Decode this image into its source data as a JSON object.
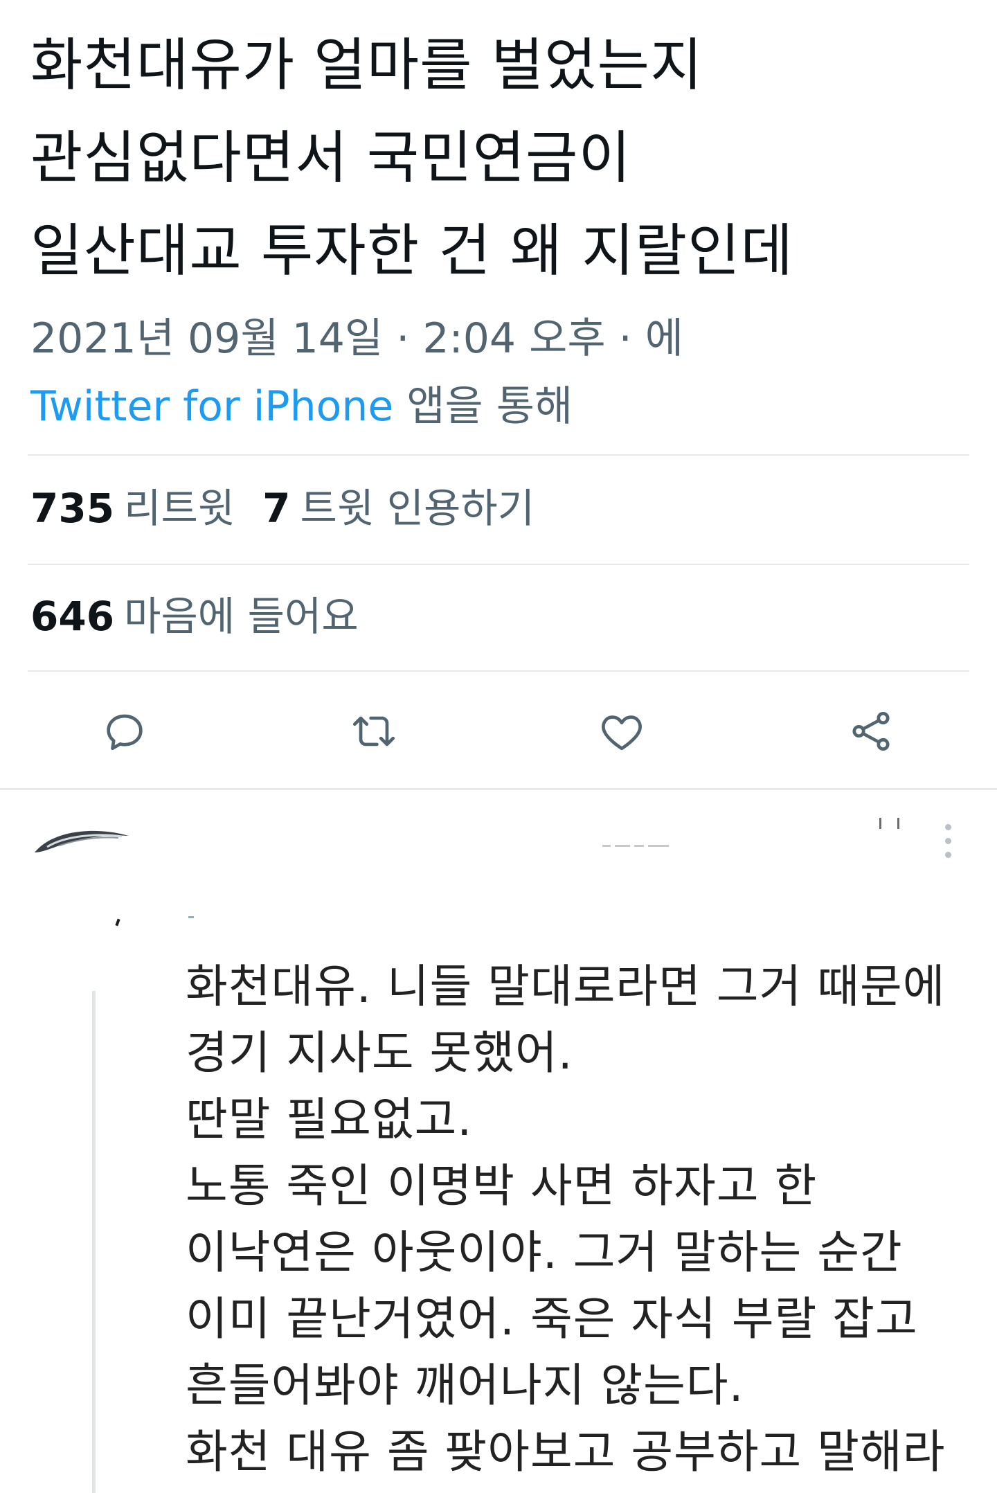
{
  "tweet": {
    "text_lines": [
      "화천대유가 얼마를 벌었는지",
      "관심없다면서 국민연금이",
      "일산대교 투자한 건 왜 지랄인데"
    ],
    "timestamp": "2021년 09월 14일 · 2:04 오후 · 에",
    "source": "Twitter for iPhone",
    "via_label": "앱을 통해"
  },
  "stats": {
    "retweets_count": "735",
    "retweets_label": "리트윗",
    "quotes_count": "7",
    "quotes_label": "트윗 인용하기",
    "likes_count": "646",
    "likes_label": "마음에 들어요"
  },
  "actions": {
    "icons": [
      "reply-icon",
      "retweet-icon",
      "like-icon",
      "share-icon"
    ],
    "icon_color": "#536471"
  },
  "reply": {
    "text_lines": [
      "화천대유. 니들 말대로라면 그거 때문에",
      "경기 지사도 못했어.",
      "딴말 필요없고.",
      "노통 죽인 이명박 사면 하자고 한",
      "이낙연은 아웃이야. 그거 말하는 순간",
      "이미 끝난거였어. 죽은 자식 부랄 잡고",
      "흔들어봐야 깨어나지 않는다.",
      "화천 대유 좀 팢아보고 공부하고 말해라"
    ],
    "more_icon": "more-vertical-icon"
  },
  "colors": {
    "text": "#0f1419",
    "secondary": "#536471",
    "link": "#1d9bf0",
    "divider": "#e7e9ea"
  }
}
